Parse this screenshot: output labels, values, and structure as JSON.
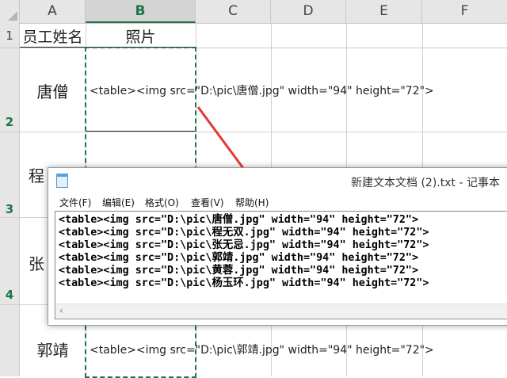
{
  "spreadsheet": {
    "columns": [
      "A",
      "B",
      "C",
      "D",
      "E",
      "F"
    ],
    "selected_column": "B",
    "rows": [
      "1",
      "2",
      "3",
      "4"
    ],
    "header_a1": "员工姓名",
    "header_b1": "照片",
    "names": [
      "唐僧",
      "程",
      "张",
      "郭靖"
    ],
    "cell_c2": "<table><img src=\"D:\\pic\\唐僧.jpg\" width=\"94\" height=\"72\">",
    "cell_c5": "<table><img src=\"D:\\pic\\郭靖.jpg\" width=\"94\" height=\"72\">",
    "accent_color": "#217346"
  },
  "notepad": {
    "title": "新建文本文档 (2).txt - 记事本",
    "menu": [
      "文件(F)",
      "编辑(E)",
      "格式(O)",
      "查看(V)",
      "帮助(H)"
    ],
    "lines": [
      "<table><img src=\"D:\\pic\\唐僧.jpg\" width=\"94\" height=\"72\">",
      "<table><img src=\"D:\\pic\\程无双.jpg\" width=\"94\" height=\"72\">",
      "<table><img src=\"D:\\pic\\张无忌.jpg\" width=\"94\" height=\"72\">",
      "<table><img src=\"D:\\pic\\郭靖.jpg\" width=\"94\" height=\"72\">",
      "<table><img src=\"D:\\pic\\黄蓉.jpg\" width=\"94\" height=\"72\">",
      "<table><img src=\"D:\\pic\\杨玉环.jpg\" width=\"94\" height=\"72\">"
    ],
    "icon": "notepad-icon",
    "scroll_icon": "chevron-left-icon"
  },
  "annotation": {
    "arrow_color": "#e53935",
    "icon": "red-arrow-icon"
  }
}
